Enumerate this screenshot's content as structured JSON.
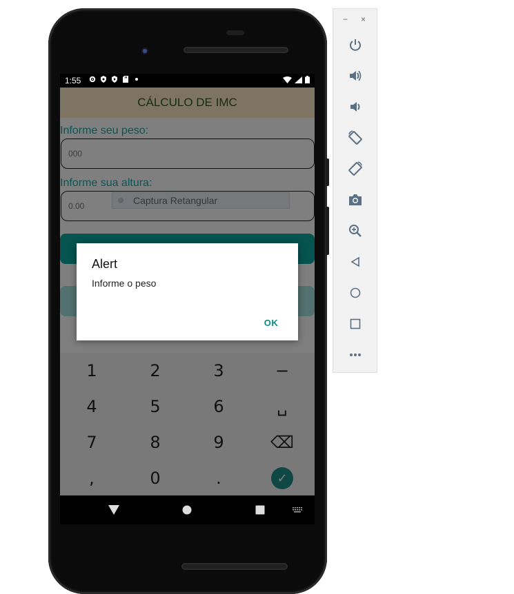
{
  "status_bar": {
    "time": "1:55"
  },
  "app": {
    "title": "CÁLCULO DE IMC"
  },
  "form": {
    "weight_label": "Informe seu peso:",
    "weight_placeholder": "000",
    "height_label": "Informe sua altura:",
    "height_placeholder": "0.00"
  },
  "tooltip": {
    "text": "Captura Retangular"
  },
  "dialog": {
    "title": "Alert",
    "message": "Informe o peso",
    "ok_label": "OK"
  },
  "keyboard": {
    "keys": [
      "1",
      "2",
      "3",
      "−",
      "4",
      "5",
      "6",
      "␣",
      "7",
      "8",
      "9",
      "⌫",
      ",",
      "0",
      ".",
      "✓"
    ]
  },
  "emulator_panel": {
    "minimize": "−",
    "close": "×",
    "tools": [
      "power-icon",
      "volume-up-icon",
      "volume-down-icon",
      "rotate-left-icon",
      "rotate-right-icon",
      "camera-icon",
      "zoom-icon",
      "back-icon",
      "home-icon",
      "overview-icon",
      "more-icon"
    ]
  },
  "colors": {
    "accent": "#1aa8a8",
    "appbar": "#fbe9c7",
    "button": "#0aa8a0",
    "ok": "#0a8a82"
  }
}
